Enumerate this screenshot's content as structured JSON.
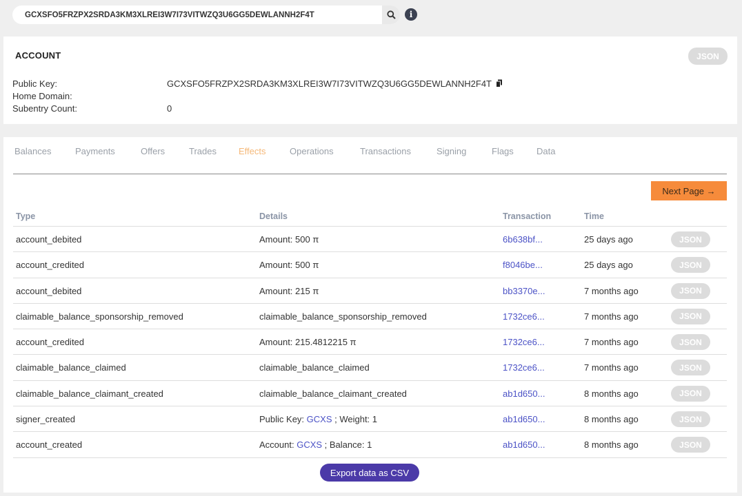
{
  "search": {
    "value": "GCXSFO5FRZPX2SRDA3KM3XLREI3W7I73VITWZQ3U6GG5DEWLANNH2F4T"
  },
  "account": {
    "title": "ACCOUNT",
    "json_label": "JSON",
    "public_key_label": "Public Key:",
    "public_key": "GCXSFO5FRZPX2SRDA3KM3XLREI3W7I73VITWZQ3U6GG5DEWLANNH2F4T",
    "home_domain_label": "Home Domain:",
    "home_domain": "",
    "subentry_label": "Subentry Count:",
    "subentry_count": "0"
  },
  "tabs": [
    {
      "label": "Balances"
    },
    {
      "label": "Payments"
    },
    {
      "label": "Offers"
    },
    {
      "label": "Trades"
    },
    {
      "label": "Effects",
      "active": true
    },
    {
      "label": "Operations"
    },
    {
      "label": "Transactions"
    },
    {
      "label": "Signing"
    },
    {
      "label": "Flags"
    },
    {
      "label": "Data"
    }
  ],
  "next_page_label": "Next Page →",
  "table": {
    "headers": {
      "type": "Type",
      "details": "Details",
      "transaction": "Transaction",
      "time": "Time"
    },
    "json_label": "JSON",
    "rows": [
      {
        "type": "account_debited",
        "details_pre": "Amount: 500 π",
        "details_link": "",
        "details_post": "",
        "tx": "6b638bf...",
        "time": "25 days ago"
      },
      {
        "type": "account_credited",
        "details_pre": "Amount: 500 π",
        "details_link": "",
        "details_post": "",
        "tx": "f8046be...",
        "time": "25 days ago"
      },
      {
        "type": "account_debited",
        "details_pre": "Amount: 215 π",
        "details_link": "",
        "details_post": "",
        "tx": "bb3370e...",
        "time": "7 months ago"
      },
      {
        "type": "claimable_balance_sponsorship_removed",
        "details_pre": "claimable_balance_sponsorship_removed",
        "details_link": "",
        "details_post": "",
        "tx": "1732ce6...",
        "time": "7 months ago"
      },
      {
        "type": "account_credited",
        "details_pre": "Amount: 215.4812215 π",
        "details_link": "",
        "details_post": "",
        "tx": "1732ce6...",
        "time": "7 months ago"
      },
      {
        "type": "claimable_balance_claimed",
        "details_pre": "claimable_balance_claimed",
        "details_link": "",
        "details_post": "",
        "tx": "1732ce6...",
        "time": "7 months ago"
      },
      {
        "type": "claimable_balance_claimant_created",
        "details_pre": "claimable_balance_claimant_created",
        "details_link": "",
        "details_post": "",
        "tx": "ab1d650...",
        "time": "8 months ago"
      },
      {
        "type": "signer_created",
        "details_pre": "Public Key: ",
        "details_link": "GCXS",
        "details_post": " ; Weight: 1",
        "tx": "ab1d650...",
        "time": "8 months ago"
      },
      {
        "type": "account_created",
        "details_pre": "Account: ",
        "details_link": "GCXS",
        "details_post": " ; Balance: 1",
        "tx": "ab1d650...",
        "time": "8 months ago"
      }
    ]
  },
  "export_label": "Export data as CSV",
  "icons": {
    "search": "search-icon",
    "info": "info-icon",
    "copy": "copy-icon"
  }
}
